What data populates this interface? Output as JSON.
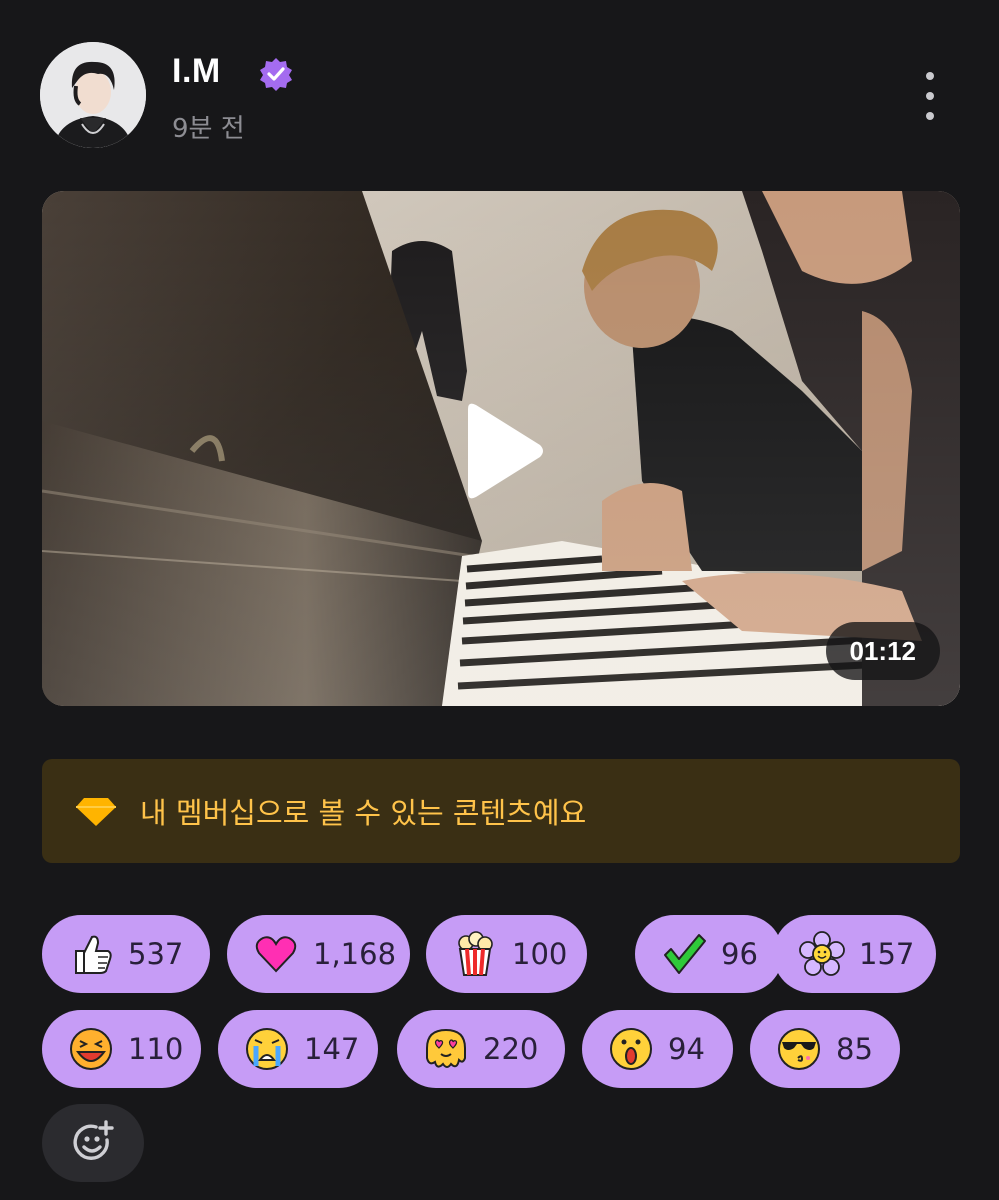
{
  "post": {
    "author_name": "I.M",
    "timestamp": "9분 전",
    "more_icon": "more-vertical-icon",
    "verified_icon": "verified-badge-icon"
  },
  "video": {
    "duration": "01:12",
    "play_icon": "play-icon"
  },
  "membership_notice": {
    "icon": "diamond-icon",
    "text": "내 멤버십으로 볼 수 있는 콘텐츠예요"
  },
  "reactions": [
    {
      "emoji": "thumbs-up-icon",
      "count": "537"
    },
    {
      "emoji": "heart-icon",
      "count": "1,168"
    },
    {
      "emoji": "popcorn-icon",
      "count": "100"
    },
    {
      "emoji": "check-mark-icon",
      "count": "96"
    },
    {
      "emoji": "flower-icon",
      "count": "157"
    },
    {
      "emoji": "laughing-face-icon",
      "count": "110"
    },
    {
      "emoji": "crying-face-icon",
      "count": "147"
    },
    {
      "emoji": "melting-heart-eyes-icon",
      "count": "220"
    },
    {
      "emoji": "surprised-face-icon",
      "count": "94"
    },
    {
      "emoji": "sunglasses-face-icon",
      "count": "85"
    }
  ],
  "add_reaction_icon": "add-emoji-icon",
  "colors": {
    "background": "#171719",
    "reaction_pill": "#c69cf6",
    "notice_background": "#3a2f14",
    "notice_text": "#ffc34a",
    "verified_badge": "#a46cf0"
  }
}
